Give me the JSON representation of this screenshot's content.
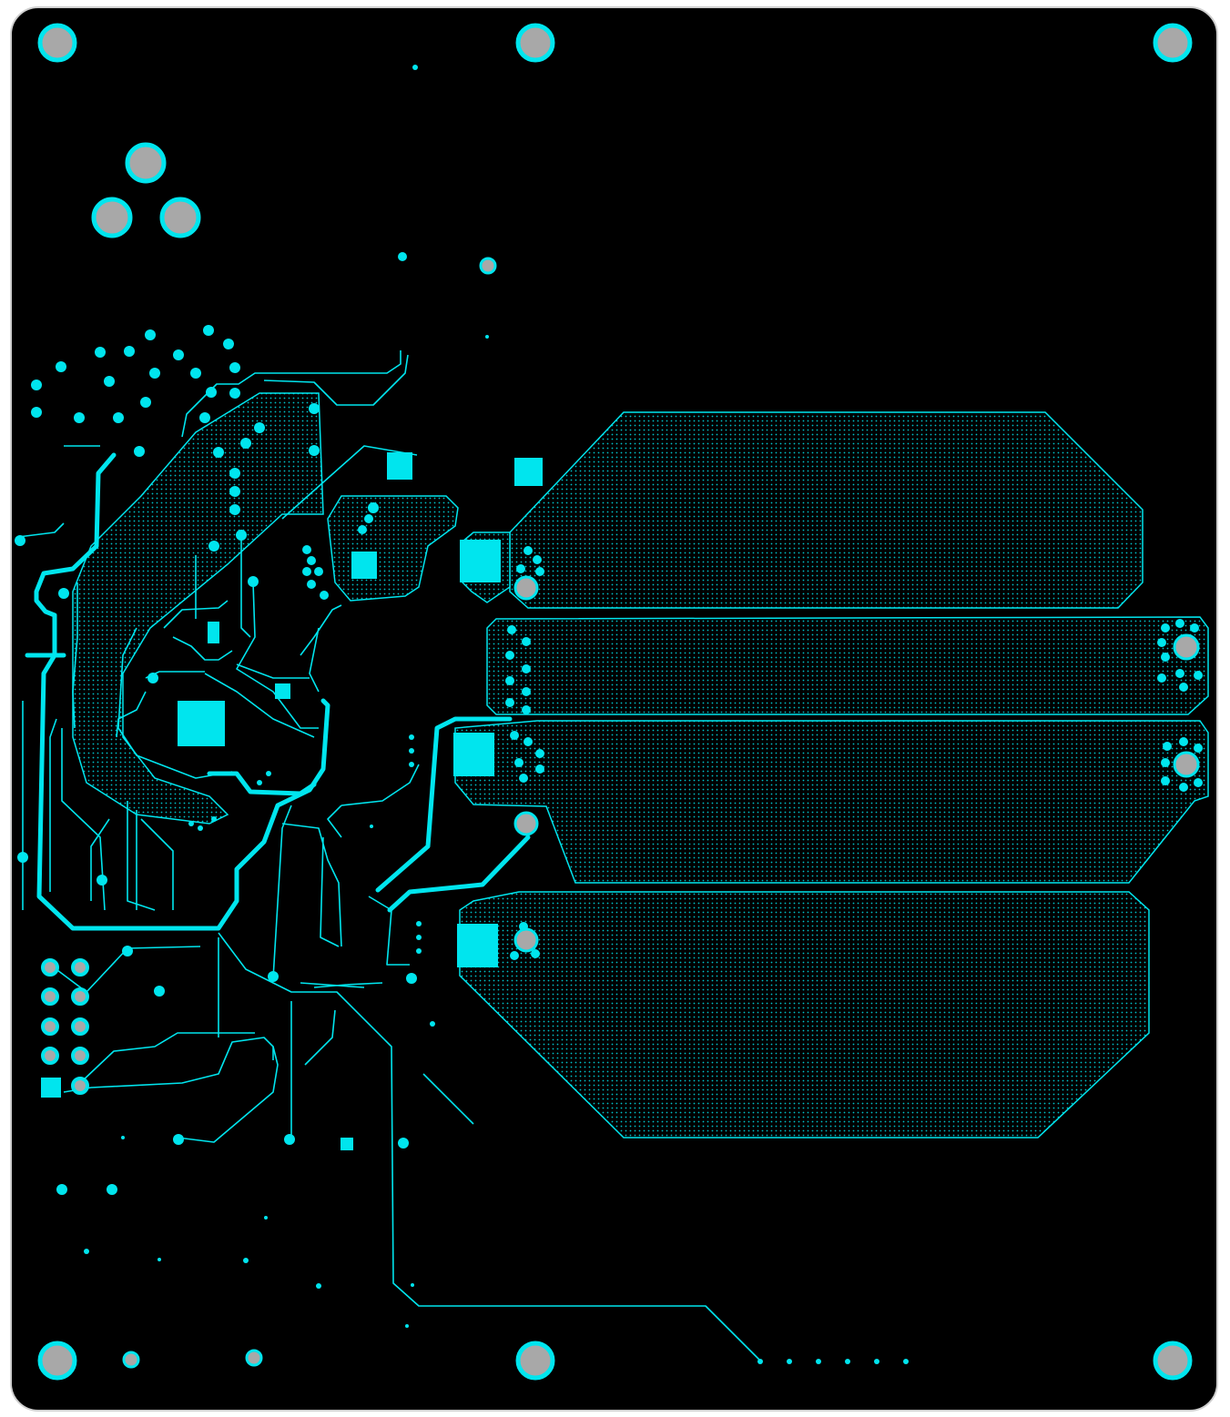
{
  "view": {
    "type": "pcb-layout",
    "layer": "copper-top",
    "colors": {
      "background": "#ffffff",
      "board": "#000000",
      "outline": "#d0d0d0",
      "copper": "#00e5ee",
      "drill": "#a8a8a8"
    }
  },
  "labels": {}
}
